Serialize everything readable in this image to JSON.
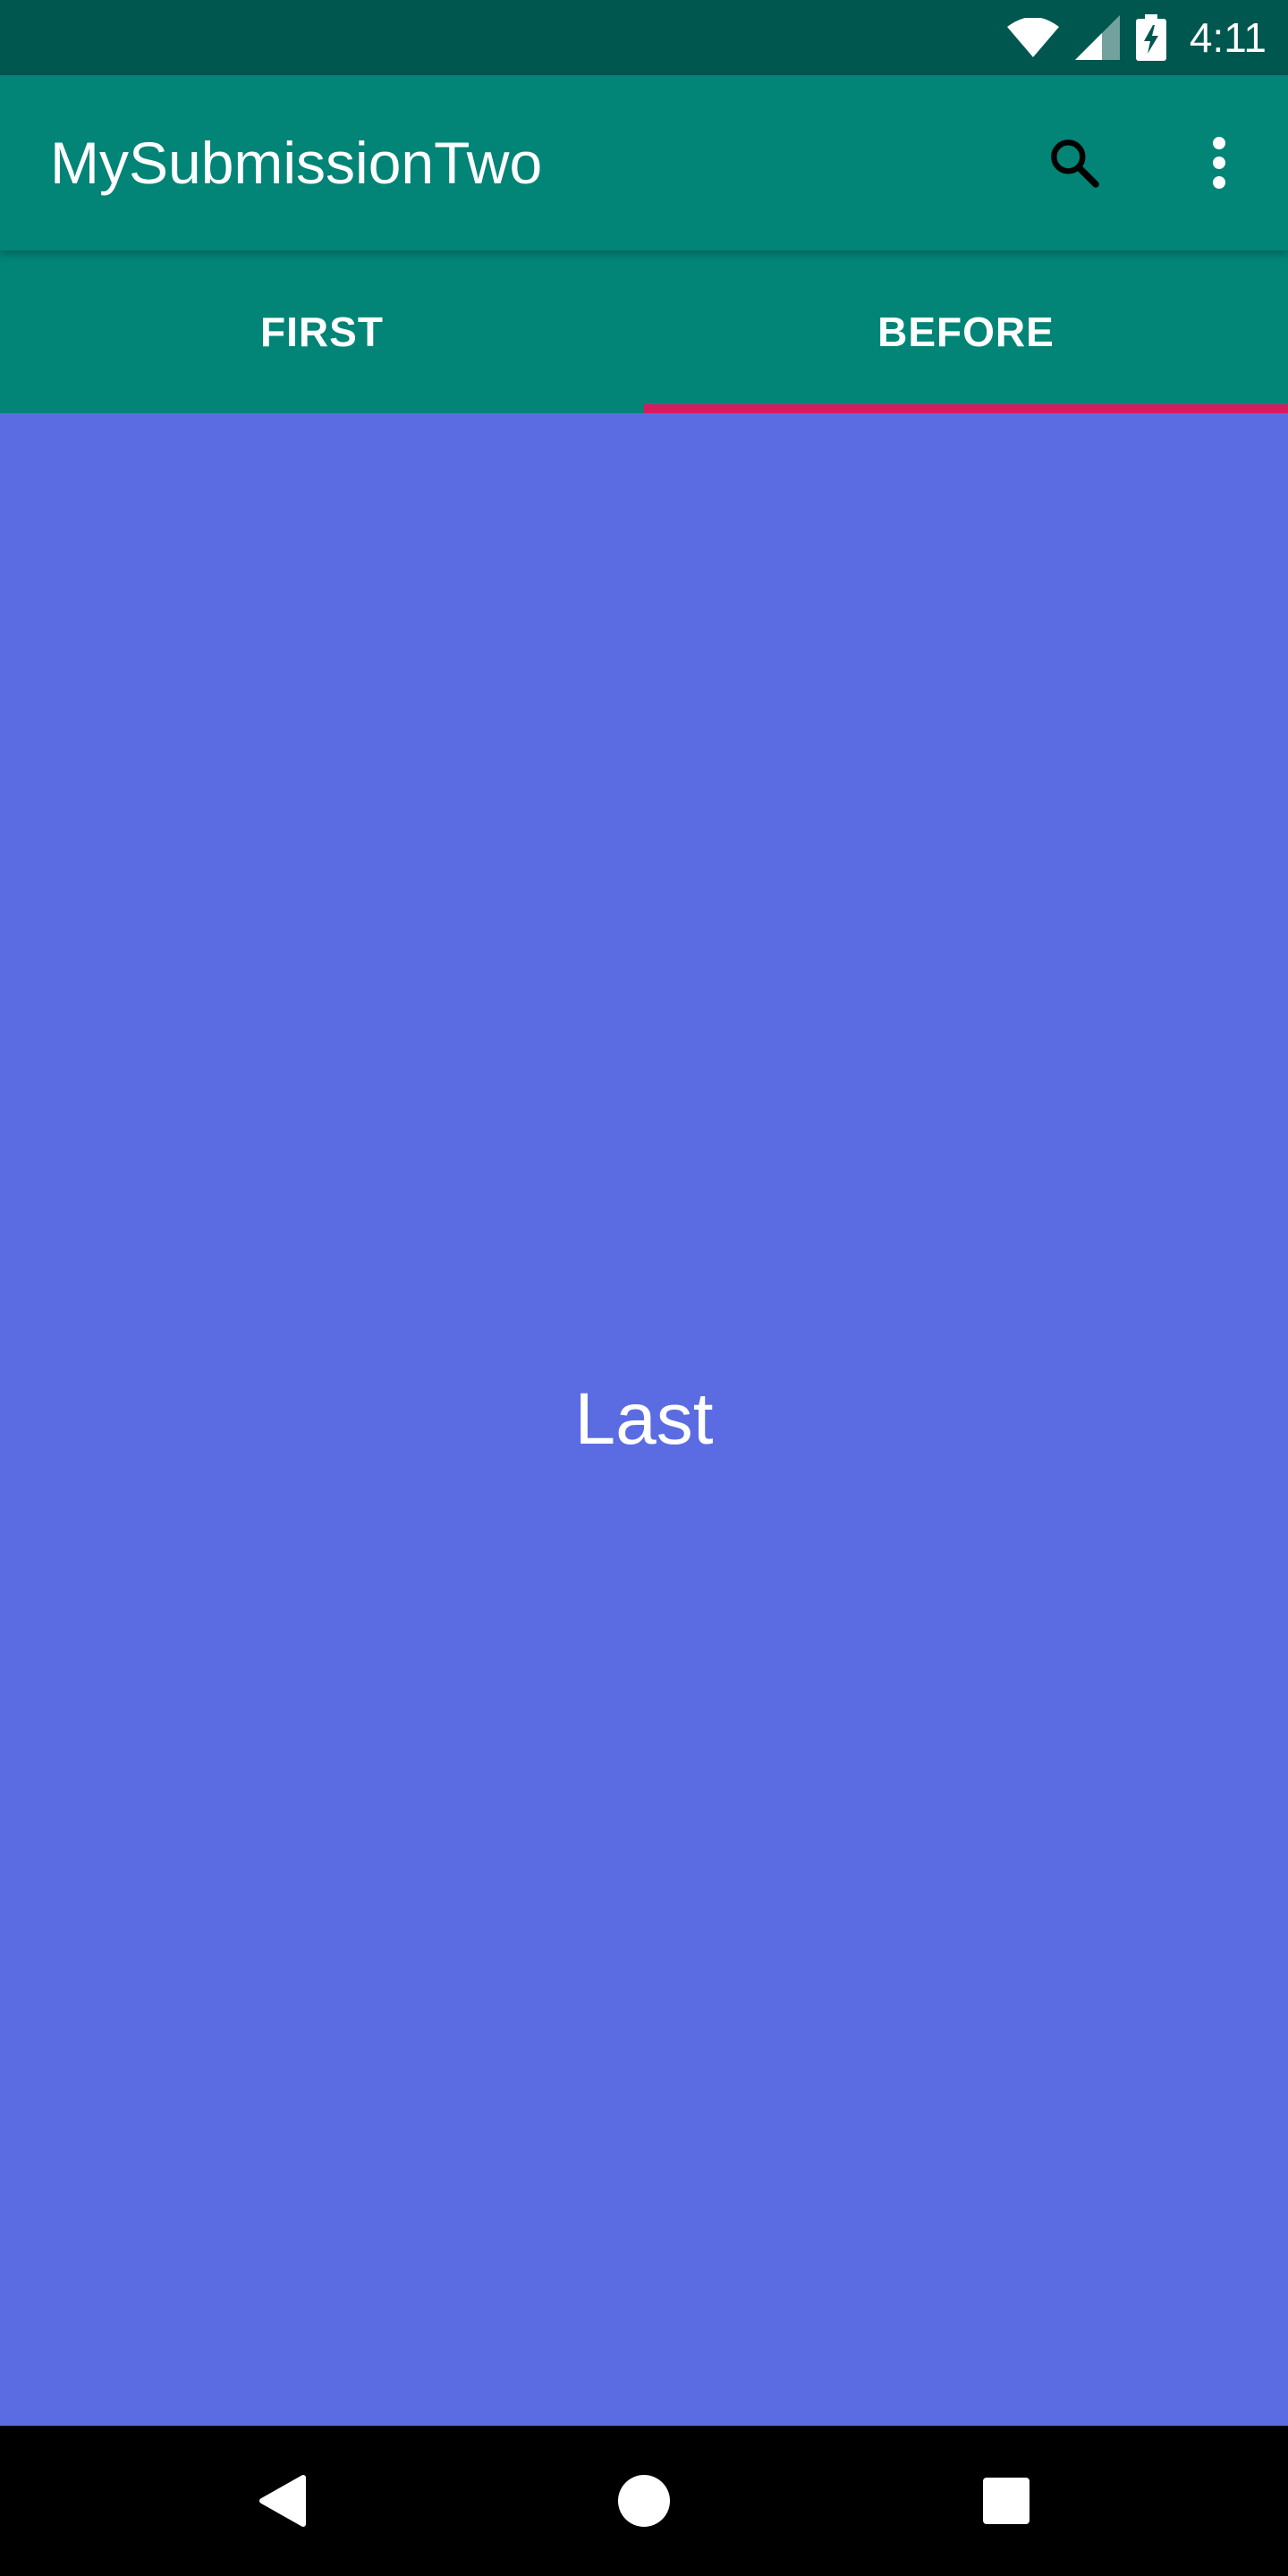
{
  "status_bar": {
    "time": "4:11",
    "icons": [
      "wifi-icon",
      "cell-signal-icon",
      "battery-charging-icon"
    ]
  },
  "app_bar": {
    "title": "MySubmissionTwo",
    "actions": [
      "search-icon",
      "overflow-menu-icon"
    ]
  },
  "tabs": [
    {
      "label": "FIRST",
      "selected": false
    },
    {
      "label": "BEFORE",
      "selected": true
    }
  ],
  "content": {
    "label": "Last",
    "background": "#5b6ce3"
  },
  "nav_bar": {
    "buttons": [
      "back-icon",
      "home-icon",
      "recents-icon"
    ]
  },
  "colors": {
    "status_bar": "#00574f",
    "primary": "#028477",
    "accent": "#d81b60"
  }
}
